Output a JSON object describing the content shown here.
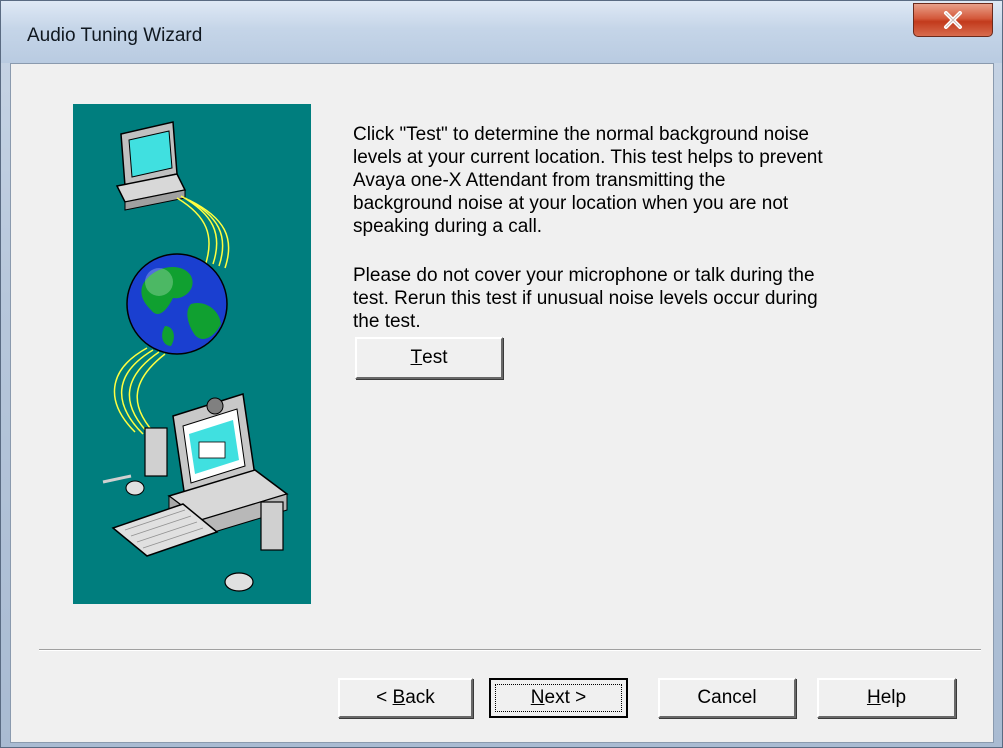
{
  "window": {
    "title": "Audio Tuning Wizard"
  },
  "content": {
    "paragraph1": "Click \"Test\" to determine the normal background noise\nlevels at your current location. This test helps to prevent\nAvaya one-X Attendant from transmitting the\nbackground noise at your location when you are not\nspeaking during a call.",
    "paragraph2": "Please do not cover your microphone or talk during the\ntest. Rerun this test if unusual noise levels occur during\nthe test."
  },
  "buttons": {
    "test": {
      "mnemonic": "T",
      "rest": "est"
    },
    "back": {
      "prefix": "< ",
      "mnemonic": "B",
      "rest": "ack"
    },
    "next": {
      "mnemonic": "N",
      "rest": "ext >"
    },
    "cancel": {
      "label": "Cancel"
    },
    "help": {
      "mnemonic": "H",
      "rest": "elp"
    }
  },
  "icons": {
    "close": "close-icon",
    "illustration": "network-computers-globe-illustration"
  },
  "colors": {
    "illustration_bg": "#007e7e",
    "close_button": "#c8452a",
    "dialog_bg": "#f0f0f0"
  }
}
